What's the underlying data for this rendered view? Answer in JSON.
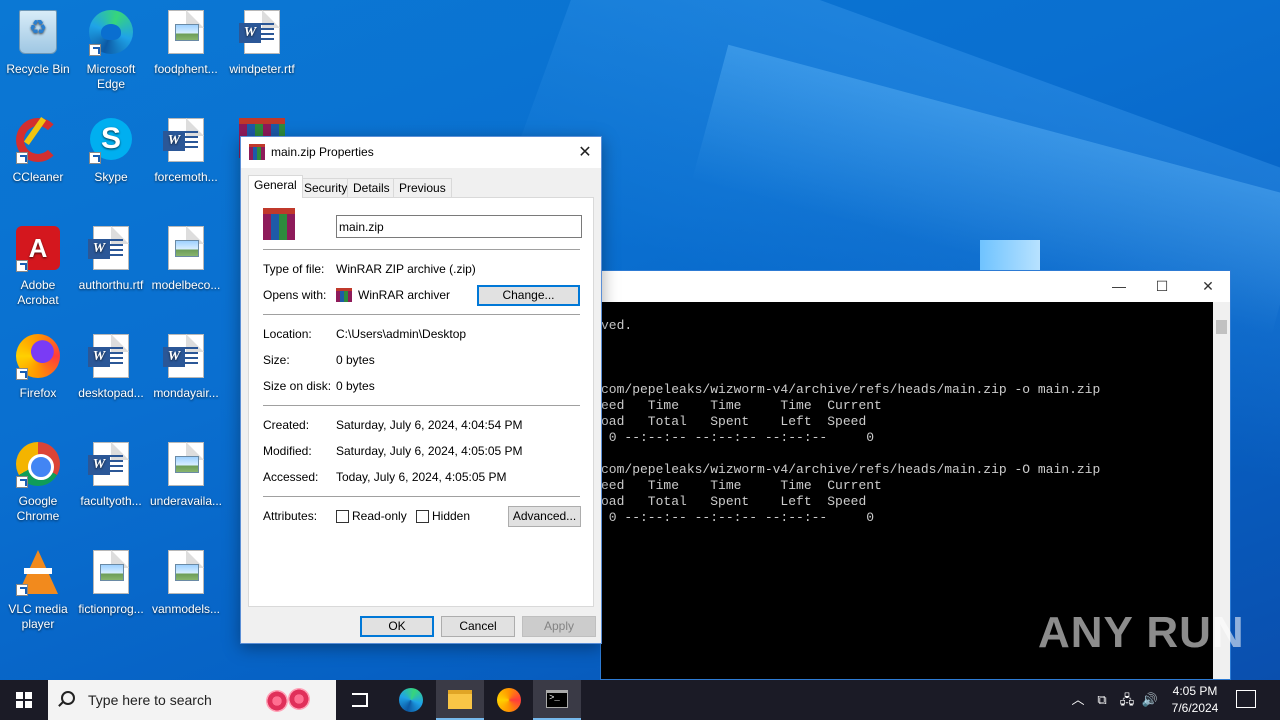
{
  "desktop": {
    "icons": [
      {
        "label": "Recycle Bin",
        "kind": "recycle-bin-icon"
      },
      {
        "label": "Microsoft Edge",
        "kind": "edge-icon"
      },
      {
        "label": "foodphent...",
        "kind": "image-file-icon"
      },
      {
        "label": "windpeter.rtf",
        "kind": "word-document-icon"
      },
      {
        "label": "CCleaner",
        "kind": "ccleaner-icon"
      },
      {
        "label": "Skype",
        "kind": "skype-icon"
      },
      {
        "label": "forcemoth...",
        "kind": "word-document-icon"
      },
      {
        "label": "Adobe Acrobat",
        "kind": "acrobat-icon"
      },
      {
        "label": "authorthu.rtf",
        "kind": "word-document-icon"
      },
      {
        "label": "modelbeco...",
        "kind": "image-file-icon"
      },
      {
        "label": "Firefox",
        "kind": "firefox-icon"
      },
      {
        "label": "desktopad...",
        "kind": "word-document-icon"
      },
      {
        "label": "mondayair...",
        "kind": "word-document-icon"
      },
      {
        "label": "Google Chrome",
        "kind": "chrome-icon"
      },
      {
        "label": "facultyoth...",
        "kind": "word-document-icon"
      },
      {
        "label": "underavaila...",
        "kind": "image-file-icon"
      },
      {
        "label": "VLC media player",
        "kind": "vlc-icon"
      },
      {
        "label": "fictionprog...",
        "kind": "image-file-icon"
      },
      {
        "label": "vanmodels...",
        "kind": "image-file-icon"
      }
    ]
  },
  "console": {
    "lines": [
      "ved.",
      "",
      "",
      "",
      "com/pepeleaks/wizworm-v4/archive/refs/heads/main.zip -o main.zip",
      "eed   Time    Time     Time  Current",
      "oad   Total   Spent    Left  Speed",
      " 0 --:--:-- --:--:-- --:--:--     0",
      "",
      "com/pepeleaks/wizworm-v4/archive/refs/heads/main.zip -O main.zip",
      "eed   Time    Time     Time  Current",
      "oad   Total   Spent    Left  Speed",
      " 0 --:--:-- --:--:-- --:--:--     0"
    ],
    "minimize": "—",
    "maximize": "☐",
    "close": "✕"
  },
  "dialog": {
    "title": "main.zip Properties",
    "close": "✕",
    "tabs": [
      "General",
      "Security",
      "Details",
      "Previous Versions"
    ],
    "file_name": "main.zip",
    "type_label": "Type of file:",
    "type_value": "WinRAR ZIP archive (.zip)",
    "opens_label": "Opens with:",
    "opens_value": "WinRAR archiver",
    "change_button": "Change...",
    "location_label": "Location:",
    "location_value": "C:\\Users\\admin\\Desktop",
    "size_label": "Size:",
    "size_value": "0 bytes",
    "size_on_disk_label": "Size on disk:",
    "size_on_disk_value": "0 bytes",
    "created_label": "Created:",
    "created_value": "Saturday, July 6, 2024, 4:04:54 PM",
    "modified_label": "Modified:",
    "modified_value": "Saturday, July 6, 2024, 4:05:05 PM",
    "accessed_label": "Accessed:",
    "accessed_value": "Today, July 6, 2024, 4:05:05 PM",
    "attributes_label": "Attributes:",
    "readonly_label": "Read-only",
    "hidden_label": "Hidden",
    "advanced_button": "Advanced...",
    "ok_button": "OK",
    "cancel_button": "Cancel",
    "apply_button": "Apply"
  },
  "taskbar": {
    "search_placeholder": "Type here to search",
    "time": "4:05 PM",
    "date": "7/6/2024",
    "tray_chevron": "︿"
  },
  "watermark": "ANY RUN"
}
